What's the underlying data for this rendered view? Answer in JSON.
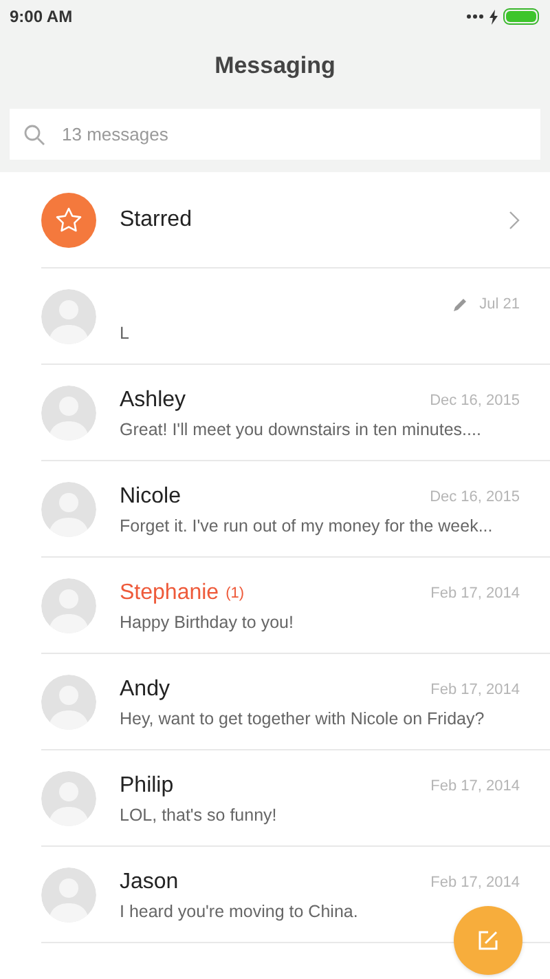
{
  "status_bar": {
    "time": "9:00 AM"
  },
  "header": {
    "title": "Messaging"
  },
  "search": {
    "placeholder": "13 messages"
  },
  "starred": {
    "label": "Starred"
  },
  "conversations": [
    {
      "draft": true,
      "date": "Jul 21",
      "preview": "L"
    },
    {
      "name": "Ashley",
      "draft": false,
      "unread": false,
      "date": "Dec 16, 2015",
      "preview": "Great! I'll meet you downstairs in ten minutes...."
    },
    {
      "name": "Nicole",
      "draft": false,
      "unread": false,
      "date": "Dec 16, 2015",
      "preview": "Forget it. I've run out of my money for the week..."
    },
    {
      "name": "Stephanie",
      "unread_count": "(1)",
      "draft": false,
      "unread": true,
      "date": "Feb 17, 2014",
      "preview": "Happy Birthday to you!"
    },
    {
      "name": "Andy",
      "draft": false,
      "unread": false,
      "date": "Feb 17, 2014",
      "preview": "Hey, want to get together with Nicole on Friday?"
    },
    {
      "name": "Philip",
      "draft": false,
      "unread": false,
      "date": "Feb 17, 2014",
      "preview": "LOL, that's so funny!"
    },
    {
      "name": "Jason",
      "draft": false,
      "unread": false,
      "date": "Feb 17, 2014",
      "preview": "I heard you're moving to China."
    }
  ]
}
